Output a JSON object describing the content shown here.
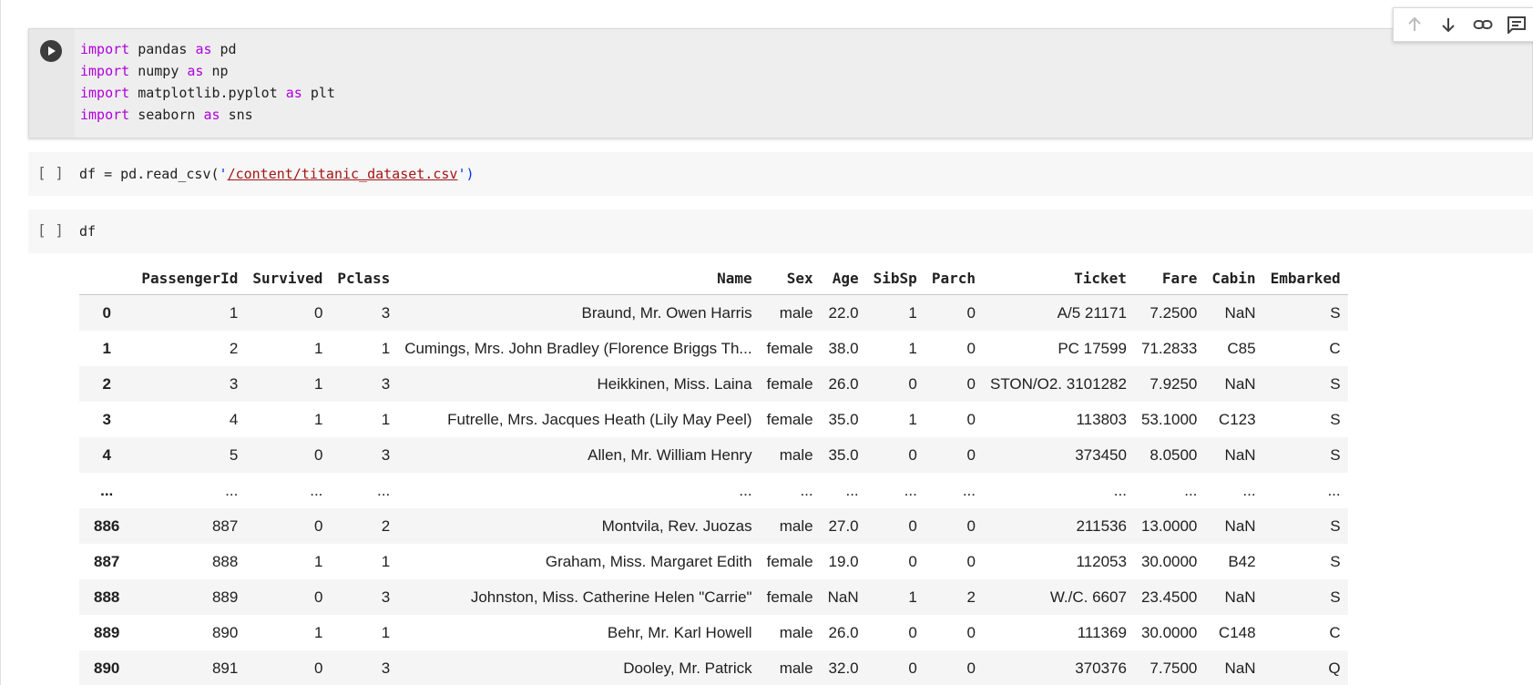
{
  "cells": {
    "imports": {
      "lines": [
        {
          "kw1": "import",
          "mod": "pandas",
          "kw2": "as",
          "alias": "pd"
        },
        {
          "kw1": "import",
          "mod": "numpy",
          "kw2": "as",
          "alias": "np"
        },
        {
          "kw1": "import",
          "mod": "matplotlib.pyplot",
          "kw2": "as",
          "alias": "plt"
        },
        {
          "kw1": "import",
          "mod": "seaborn",
          "kw2": "as",
          "alias": "sns"
        }
      ]
    },
    "read_csv": {
      "exec_count": "[ ]",
      "prefix": "df = pd.read_csv(",
      "quote_open": "'",
      "path": "/content/titanic_dataset.csv",
      "quote_close": "'",
      "suffix": ")"
    },
    "show_df": {
      "exec_count": "[ ]",
      "code": "df"
    }
  },
  "toolbar": {
    "buttons": [
      "move-up",
      "move-down",
      "link",
      "comment"
    ]
  },
  "dataframe": {
    "columns": [
      "PassengerId",
      "Survived",
      "Pclass",
      "Name",
      "Sex",
      "Age",
      "SibSp",
      "Parch",
      "Ticket",
      "Fare",
      "Cabin",
      "Embarked"
    ],
    "rows": [
      {
        "index": "0",
        "cells": [
          "1",
          "0",
          "3",
          "Braund, Mr. Owen Harris",
          "male",
          "22.0",
          "1",
          "0",
          "A/5 21171",
          "7.2500",
          "NaN",
          "S"
        ]
      },
      {
        "index": "1",
        "cells": [
          "2",
          "1",
          "1",
          "Cumings, Mrs. John Bradley (Florence Briggs Th...",
          "female",
          "38.0",
          "1",
          "0",
          "PC 17599",
          "71.2833",
          "C85",
          "C"
        ]
      },
      {
        "index": "2",
        "cells": [
          "3",
          "1",
          "3",
          "Heikkinen, Miss. Laina",
          "female",
          "26.0",
          "0",
          "0",
          "STON/O2. 3101282",
          "7.9250",
          "NaN",
          "S"
        ]
      },
      {
        "index": "3",
        "cells": [
          "4",
          "1",
          "1",
          "Futrelle, Mrs. Jacques Heath (Lily May Peel)",
          "female",
          "35.0",
          "1",
          "0",
          "113803",
          "53.1000",
          "C123",
          "S"
        ]
      },
      {
        "index": "4",
        "cells": [
          "5",
          "0",
          "3",
          "Allen, Mr. William Henry",
          "male",
          "35.0",
          "0",
          "0",
          "373450",
          "8.0500",
          "NaN",
          "S"
        ]
      },
      {
        "index": "...",
        "cells": [
          "...",
          "...",
          "...",
          "...",
          "...",
          "...",
          "...",
          "...",
          "...",
          "...",
          "...",
          "..."
        ]
      },
      {
        "index": "886",
        "cells": [
          "887",
          "0",
          "2",
          "Montvila, Rev. Juozas",
          "male",
          "27.0",
          "0",
          "0",
          "211536",
          "13.0000",
          "NaN",
          "S"
        ]
      },
      {
        "index": "887",
        "cells": [
          "888",
          "1",
          "1",
          "Graham, Miss. Margaret Edith",
          "female",
          "19.0",
          "0",
          "0",
          "112053",
          "30.0000",
          "B42",
          "S"
        ]
      },
      {
        "index": "888",
        "cells": [
          "889",
          "0",
          "3",
          "Johnston, Miss. Catherine Helen \"Carrie\"",
          "female",
          "NaN",
          "1",
          "2",
          "W./C. 6607",
          "23.4500",
          "NaN",
          "S"
        ]
      },
      {
        "index": "889",
        "cells": [
          "890",
          "1",
          "1",
          "Behr, Mr. Karl Howell",
          "male",
          "26.0",
          "0",
          "0",
          "111369",
          "30.0000",
          "C148",
          "C"
        ]
      },
      {
        "index": "890",
        "cells": [
          "891",
          "0",
          "3",
          "Dooley, Mr. Patrick",
          "male",
          "32.0",
          "0",
          "0",
          "370376",
          "7.7500",
          "NaN",
          "Q"
        ]
      }
    ]
  }
}
